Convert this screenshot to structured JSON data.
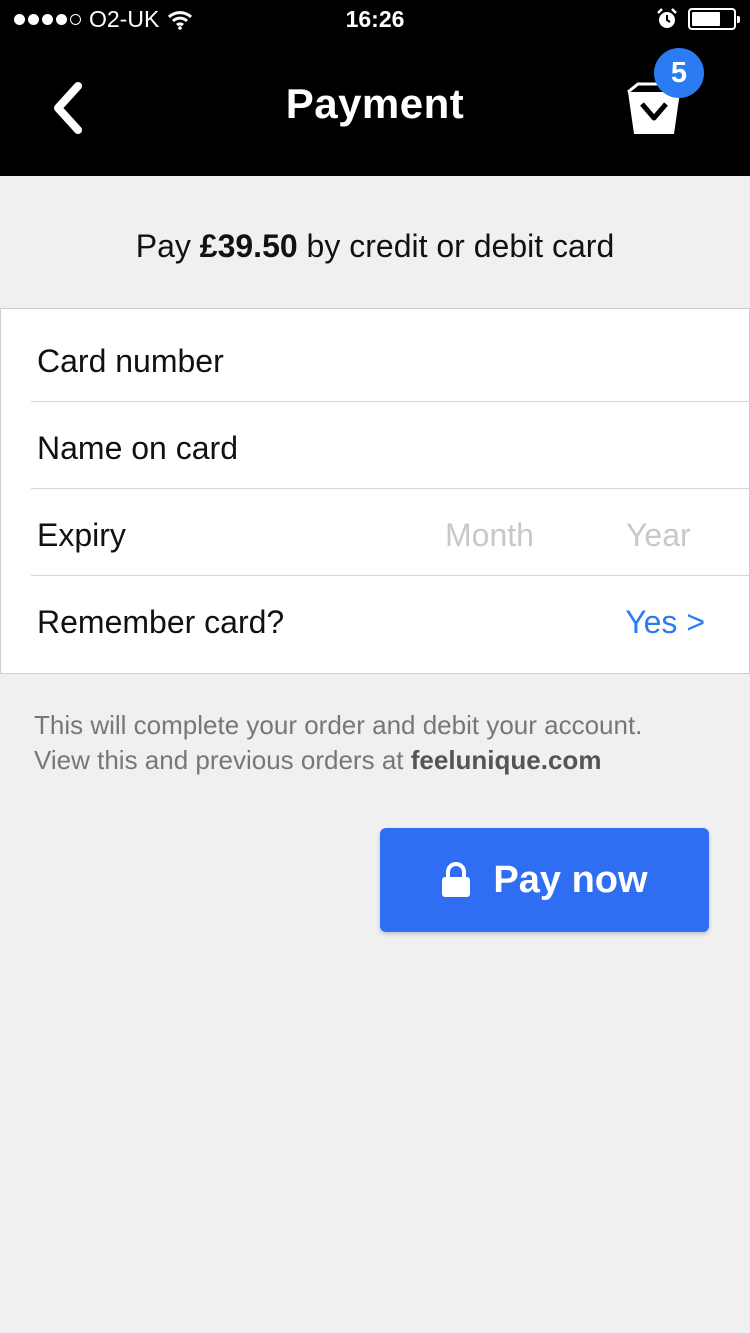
{
  "status_bar": {
    "carrier": "O2-UK",
    "time": "16:26",
    "icons": [
      "signal-dots-icon",
      "wifi-icon",
      "alarm-icon",
      "battery-icon"
    ]
  },
  "nav": {
    "title": "Payment",
    "back_icon": "chevron-left-icon",
    "basket_icon": "basket-icon",
    "basket_count": "5"
  },
  "summary": {
    "prefix": "Pay ",
    "amount": "£39.50",
    "suffix": " by credit or debit card"
  },
  "form": {
    "card_number_label": "Card number",
    "name_label": "Name on card",
    "expiry_label": "Expiry",
    "month_placeholder": "Month",
    "year_placeholder": "Year",
    "remember_label": "Remember card?",
    "remember_value": "Yes >"
  },
  "info": {
    "line1": "This will complete your order and debit your account.",
    "line2_prefix": "View this and previous orders at ",
    "site": "feelunique.com"
  },
  "pay_button": {
    "label": "Pay now",
    "icon": "lock-icon"
  },
  "colors": {
    "accent": "#2b7cf2",
    "button": "#2f6ef2",
    "nav_background": "#000000",
    "page_background": "#f0f0f0"
  }
}
